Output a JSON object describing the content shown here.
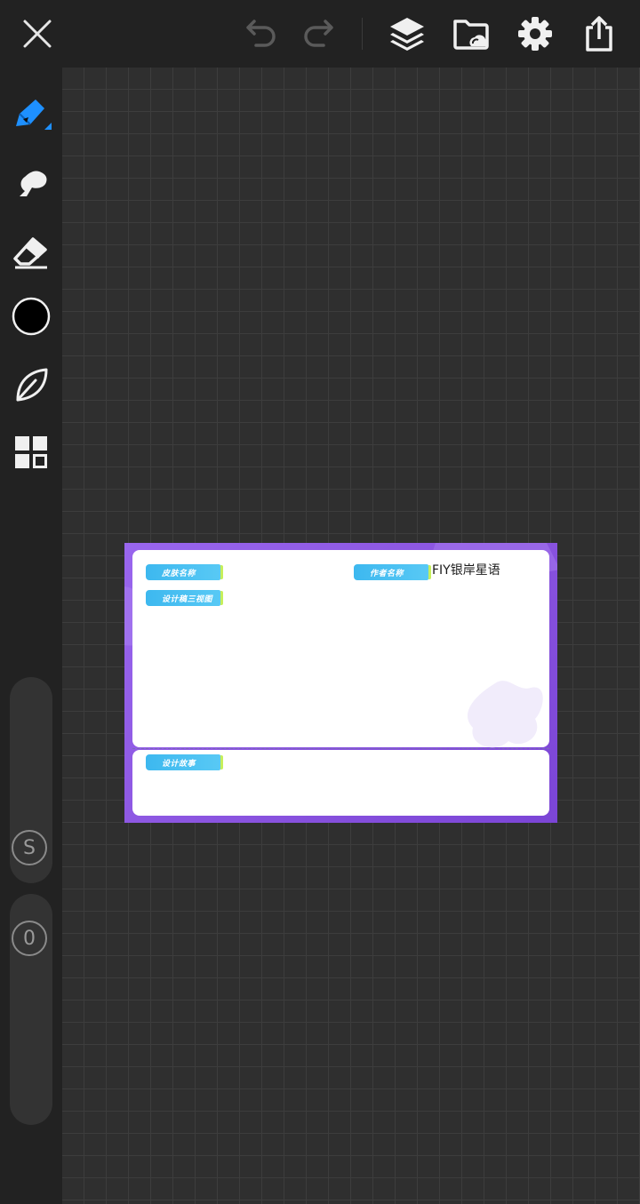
{
  "toolbar": {
    "close_icon": "close-icon",
    "undo_icon": "undo-icon",
    "redo_icon": "redo-icon",
    "layers_icon": "layers-icon",
    "folder_icon": "folder-cloud-icon",
    "settings_icon": "gear-icon",
    "share_icon": "share-icon"
  },
  "tools": [
    {
      "name": "pen",
      "icon": "pen-icon",
      "active": true
    },
    {
      "name": "smudge",
      "icon": "smudge-icon"
    },
    {
      "name": "eraser",
      "icon": "eraser-icon"
    },
    {
      "name": "color",
      "icon": "color-swatch",
      "color": "#000000"
    },
    {
      "name": "brush-library",
      "icon": "leaf-icon"
    },
    {
      "name": "gallery",
      "icon": "grid-icon"
    }
  ],
  "size_slider": {
    "label": "S"
  },
  "opacity_slider": {
    "label": "0"
  },
  "artboard": {
    "skin_name_label": "皮肤名称",
    "author_name_label": "作者名称",
    "author_name_value": "FIY银岸星语",
    "design_views_label": "设计稿三视图",
    "design_story_label": "设计故事"
  },
  "colors": {
    "accent": "#1e90ff",
    "artboard_purple": "#8b55e0",
    "tag_blue": "#3db8ef"
  }
}
